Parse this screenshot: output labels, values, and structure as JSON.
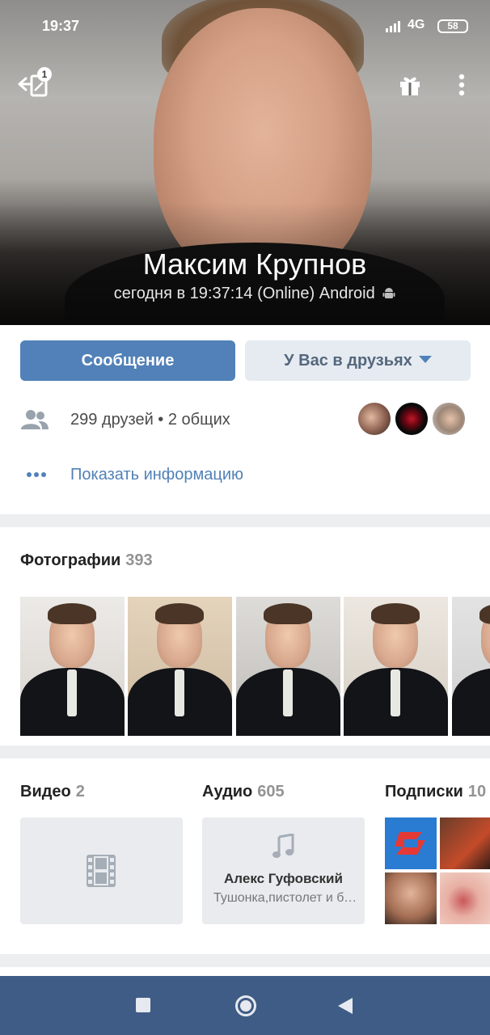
{
  "status_bar": {
    "time": "19:37",
    "network": "4G",
    "battery": "58"
  },
  "header": {
    "notification_count": "1",
    "name": "Максим Крупнов",
    "last_seen": "сегодня в 19:37:14 (Online) Android"
  },
  "actions": {
    "message_label": "Сообщение",
    "friend_status_label": "У Вас в друзьях"
  },
  "friends": {
    "summary": "299 друзей • 2 общих"
  },
  "info": {
    "show_info_label": "Показать информацию"
  },
  "photos": {
    "title": "Фотографии",
    "count": "393"
  },
  "media": {
    "video": {
      "title": "Видео",
      "count": "2"
    },
    "audio": {
      "title": "Аудио",
      "count": "605",
      "artist": "Алекс Гуфовский",
      "track": "Тушонка,пистолет и бутылка водки"
    },
    "subscriptions": {
      "title": "Подписки",
      "count": "10"
    }
  },
  "colors": {
    "accent": "#5181b8",
    "secondary_button": "#e5ebf1",
    "nav_bar": "#3f5c86"
  }
}
